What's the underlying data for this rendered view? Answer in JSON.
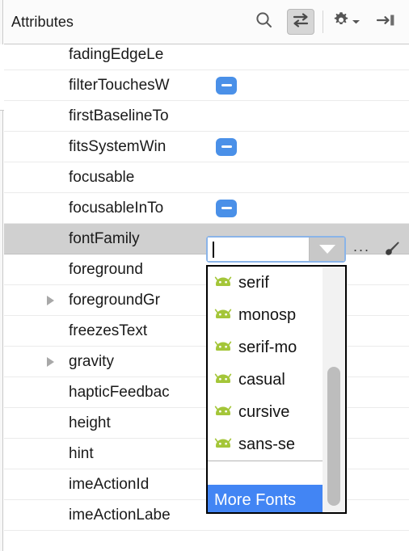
{
  "panel": {
    "title": "Attributes",
    "toolbar": [
      {
        "name": "search-icon",
        "tooltip": "Search",
        "active": false
      },
      {
        "name": "sort-swap-icon",
        "tooltip": "Sort",
        "active": true
      },
      {
        "name": "gear-icon",
        "tooltip": "Settings",
        "active": false
      },
      {
        "name": "collapse-right-icon",
        "tooltip": "Hide",
        "active": false
      }
    ]
  },
  "rows": [
    {
      "name": "fadingEdgeLe",
      "value_type": "none",
      "expandable": false,
      "selected": false
    },
    {
      "name": "filterTouchesW",
      "value_type": "checkbox-false",
      "expandable": false,
      "selected": false
    },
    {
      "name": "firstBaselineTo",
      "value_type": "none",
      "expandable": false,
      "selected": false
    },
    {
      "name": "fitsSystemWin",
      "value_type": "checkbox-false",
      "expandable": false,
      "selected": false
    },
    {
      "name": "focusable",
      "value_type": "none",
      "expandable": false,
      "selected": false
    },
    {
      "name": "focusableInTo",
      "value_type": "checkbox-false",
      "expandable": false,
      "selected": false
    },
    {
      "name": "fontFamily",
      "value_type": "combo",
      "expandable": false,
      "selected": true
    },
    {
      "name": "foreground",
      "value_type": "none",
      "expandable": false,
      "selected": false
    },
    {
      "name": "foregroundGr",
      "value_type": "none",
      "expandable": true,
      "selected": false
    },
    {
      "name": "freezesText",
      "value_type": "none",
      "expandable": false,
      "selected": false
    },
    {
      "name": "gravity",
      "value_type": "none",
      "expandable": true,
      "selected": false
    },
    {
      "name": "hapticFeedbac",
      "value_type": "none",
      "expandable": false,
      "selected": false
    },
    {
      "name": "height",
      "value_type": "none",
      "expandable": false,
      "selected": false
    },
    {
      "name": "hint",
      "value_type": "none",
      "expandable": false,
      "selected": false
    },
    {
      "name": "imeActionId",
      "value_type": "none",
      "expandable": false,
      "selected": false
    },
    {
      "name": "imeActionLabe",
      "value_type": "none",
      "expandable": false,
      "selected": false
    }
  ],
  "editor": {
    "combo_value": "",
    "combo_placeholder": "",
    "extra_buttons": {
      "ellipsis": "...",
      "pick_tool": "brush-icon"
    }
  },
  "dropdown": {
    "open": true,
    "items": [
      {
        "label": "serif",
        "icon": "android-icon"
      },
      {
        "label": "monosp",
        "icon": "android-icon"
      },
      {
        "label": "serif-mo",
        "icon": "android-icon"
      },
      {
        "label": "casual",
        "icon": "android-icon"
      },
      {
        "label": "cursive",
        "icon": "android-icon"
      },
      {
        "label": "sans-se",
        "icon": "android-icon"
      }
    ],
    "footer": {
      "label": "More Fonts",
      "highlighted": true
    }
  },
  "colors": {
    "selection_blue": "#4285f4",
    "checkbox_blue": "#4a90e8",
    "android_green": "#a4c639",
    "row_selected_gray": "#d0d0d0",
    "header_bg": "#fbfbfb"
  }
}
